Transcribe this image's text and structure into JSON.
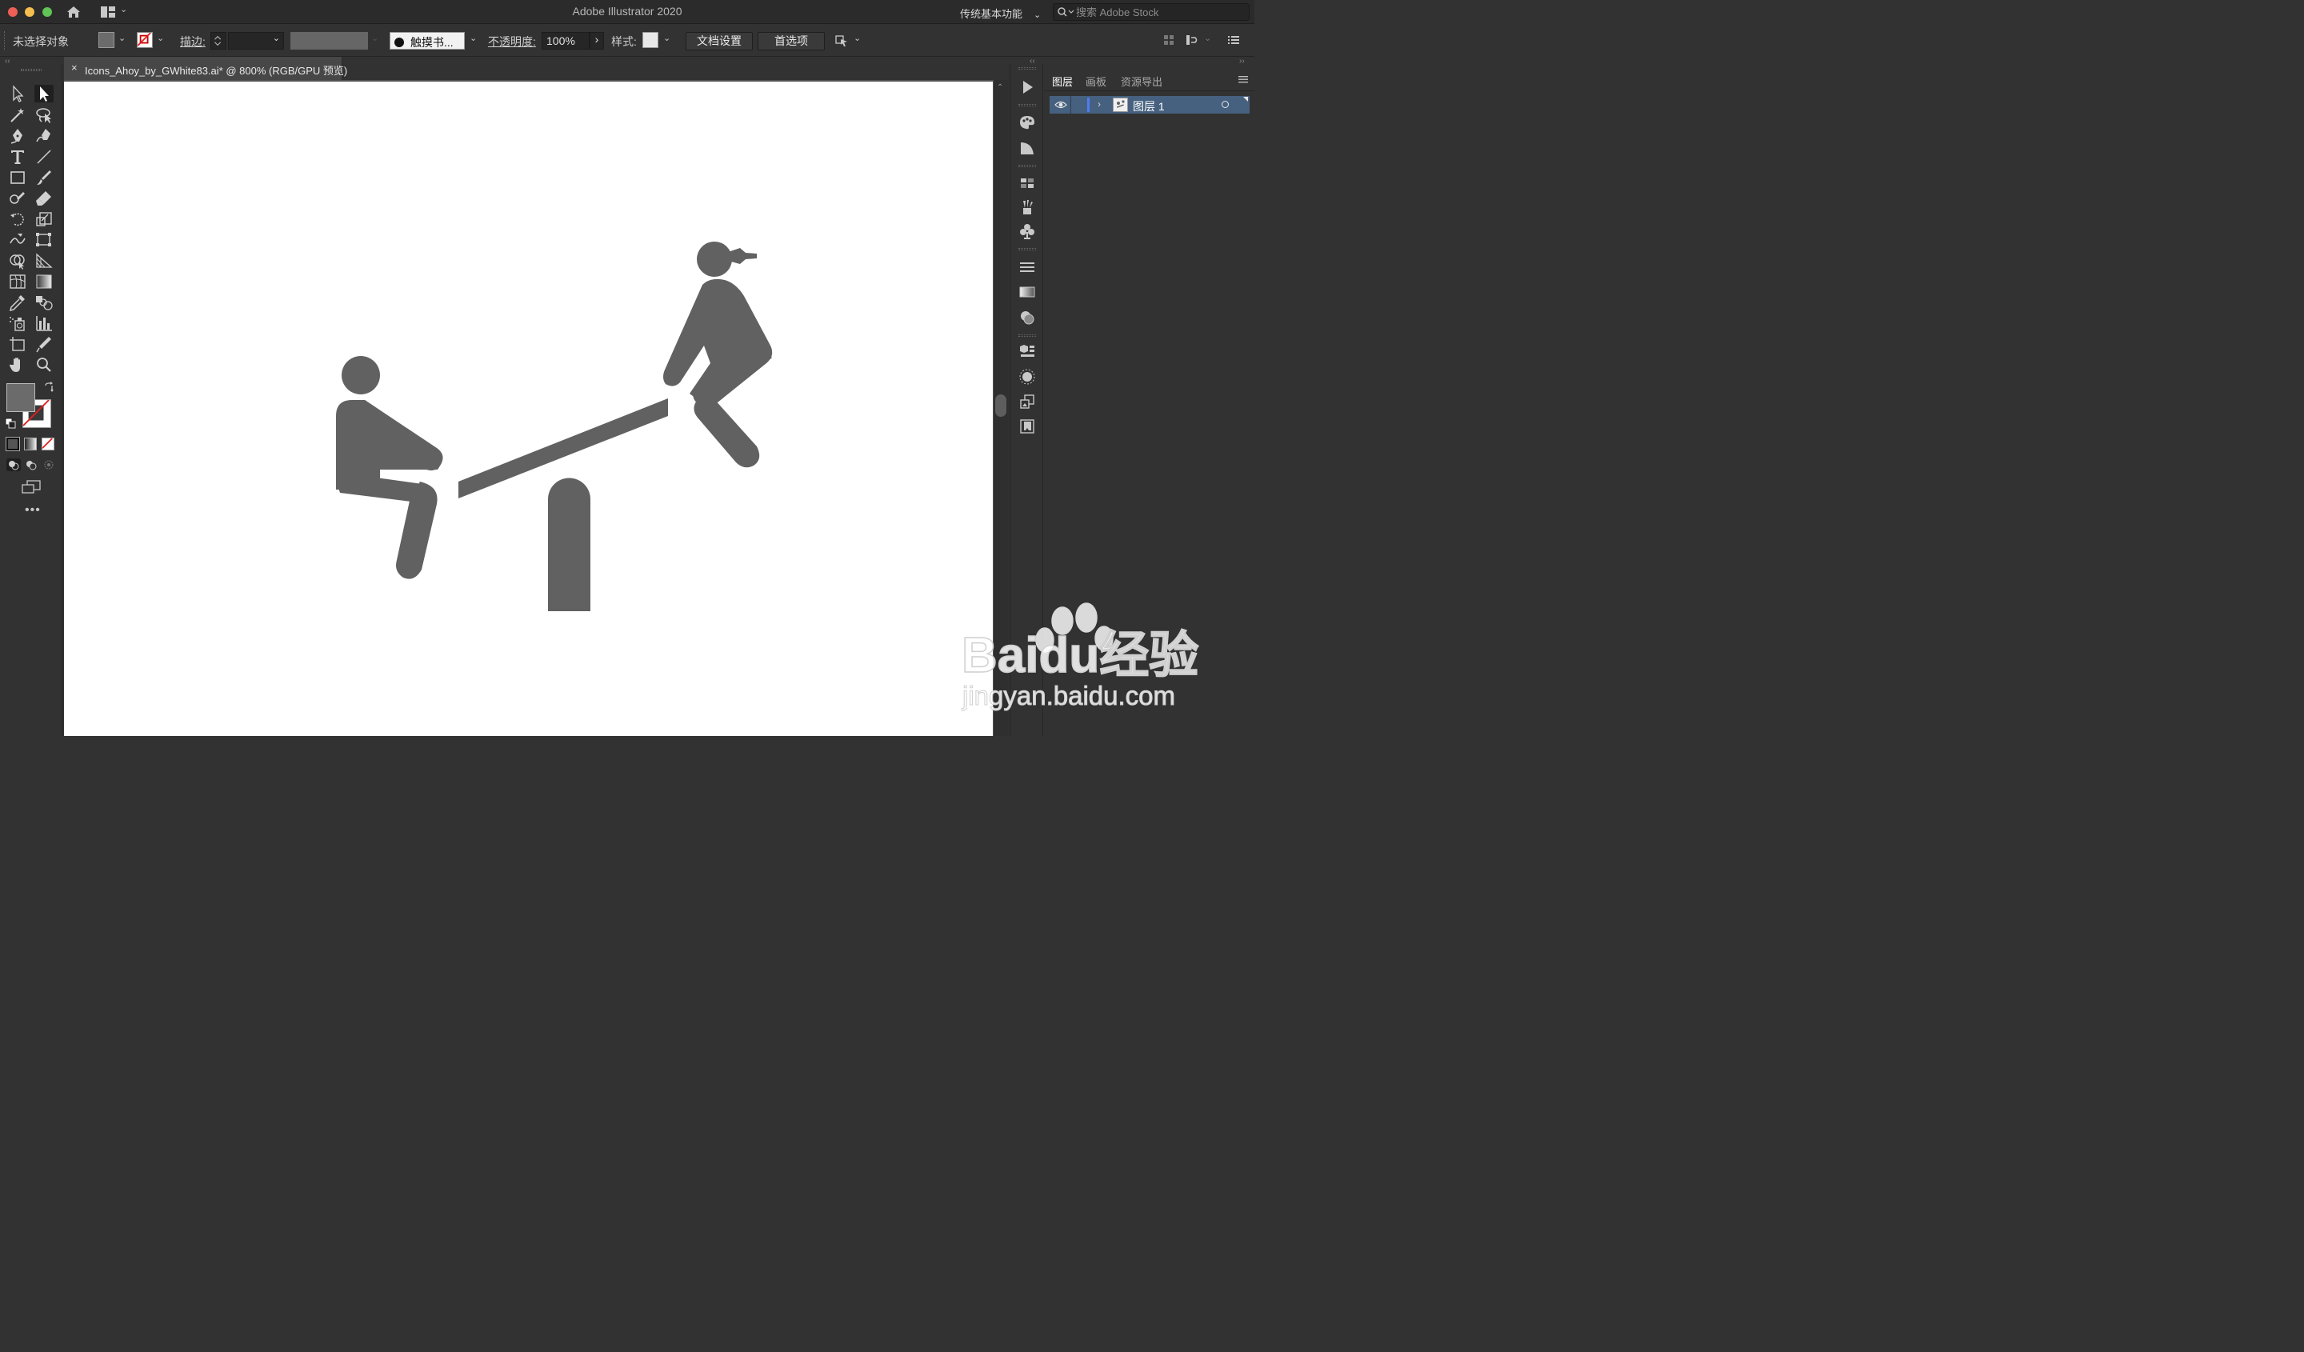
{
  "window": {
    "title": "Adobe Illustrator 2020",
    "workspace": "传统基本功能",
    "stock_search_placeholder": "搜索 Adobe Stock"
  },
  "control_bar": {
    "selection_status": "未选择对象",
    "stroke_label": "描边",
    "brush_label": "触摸书...",
    "opacity_label": "不透明度",
    "opacity_value": "100%",
    "style_label": "样式",
    "doc_setup_button": "文档设置",
    "preferences_button": "首选项"
  },
  "document": {
    "tab_title": "Icons_Ahoy_by_GWhite83.ai* @ 800% (RGB/GPU 预览)"
  },
  "artwork": {
    "subject": "seesaw-pictogram",
    "fill_color": "#616161"
  },
  "colors": {
    "fill_swatch": "#6b6b6b",
    "accent_layer_row": "#46607f",
    "layer_color_bar": "#4f7df0"
  },
  "layers_panel": {
    "tabs": [
      "图层",
      "画板",
      "资源导出"
    ],
    "layers": [
      {
        "name": "图层 1",
        "visible": true,
        "selected": true
      }
    ]
  },
  "watermark": {
    "brand": "Baidu经验",
    "url": "jingyan.baidu.com"
  }
}
